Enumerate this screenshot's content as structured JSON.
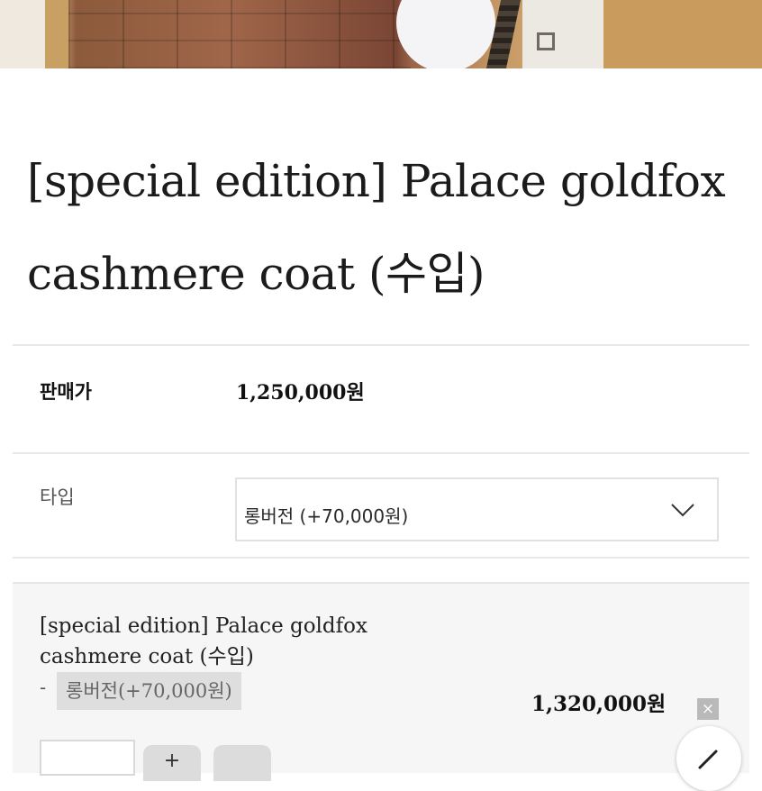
{
  "product": {
    "title": "[special edition] Palace goldfox cashmere coat (수입)"
  },
  "price_row": {
    "label": "판매가",
    "value": "1,250,000원"
  },
  "option_row": {
    "label": "타입",
    "selected": "롱버전 (+70,000원)"
  },
  "selected_item": {
    "name": "[special edition] Palace goldfox cashmere coat (수입)",
    "dash": "-",
    "option_badge": "롱버전(+70,000원)",
    "total": "1,320,000원",
    "remove_icon": "×",
    "plus_icon": "+"
  },
  "icons": {
    "dropdown": "chevron-down-icon",
    "remove": "close-icon",
    "fab": "pencil-icon"
  },
  "colors": {
    "text": "#1c1c1c",
    "divider": "#e8e8e8",
    "panel": "#f6f6f6",
    "badge": "#dedede"
  }
}
